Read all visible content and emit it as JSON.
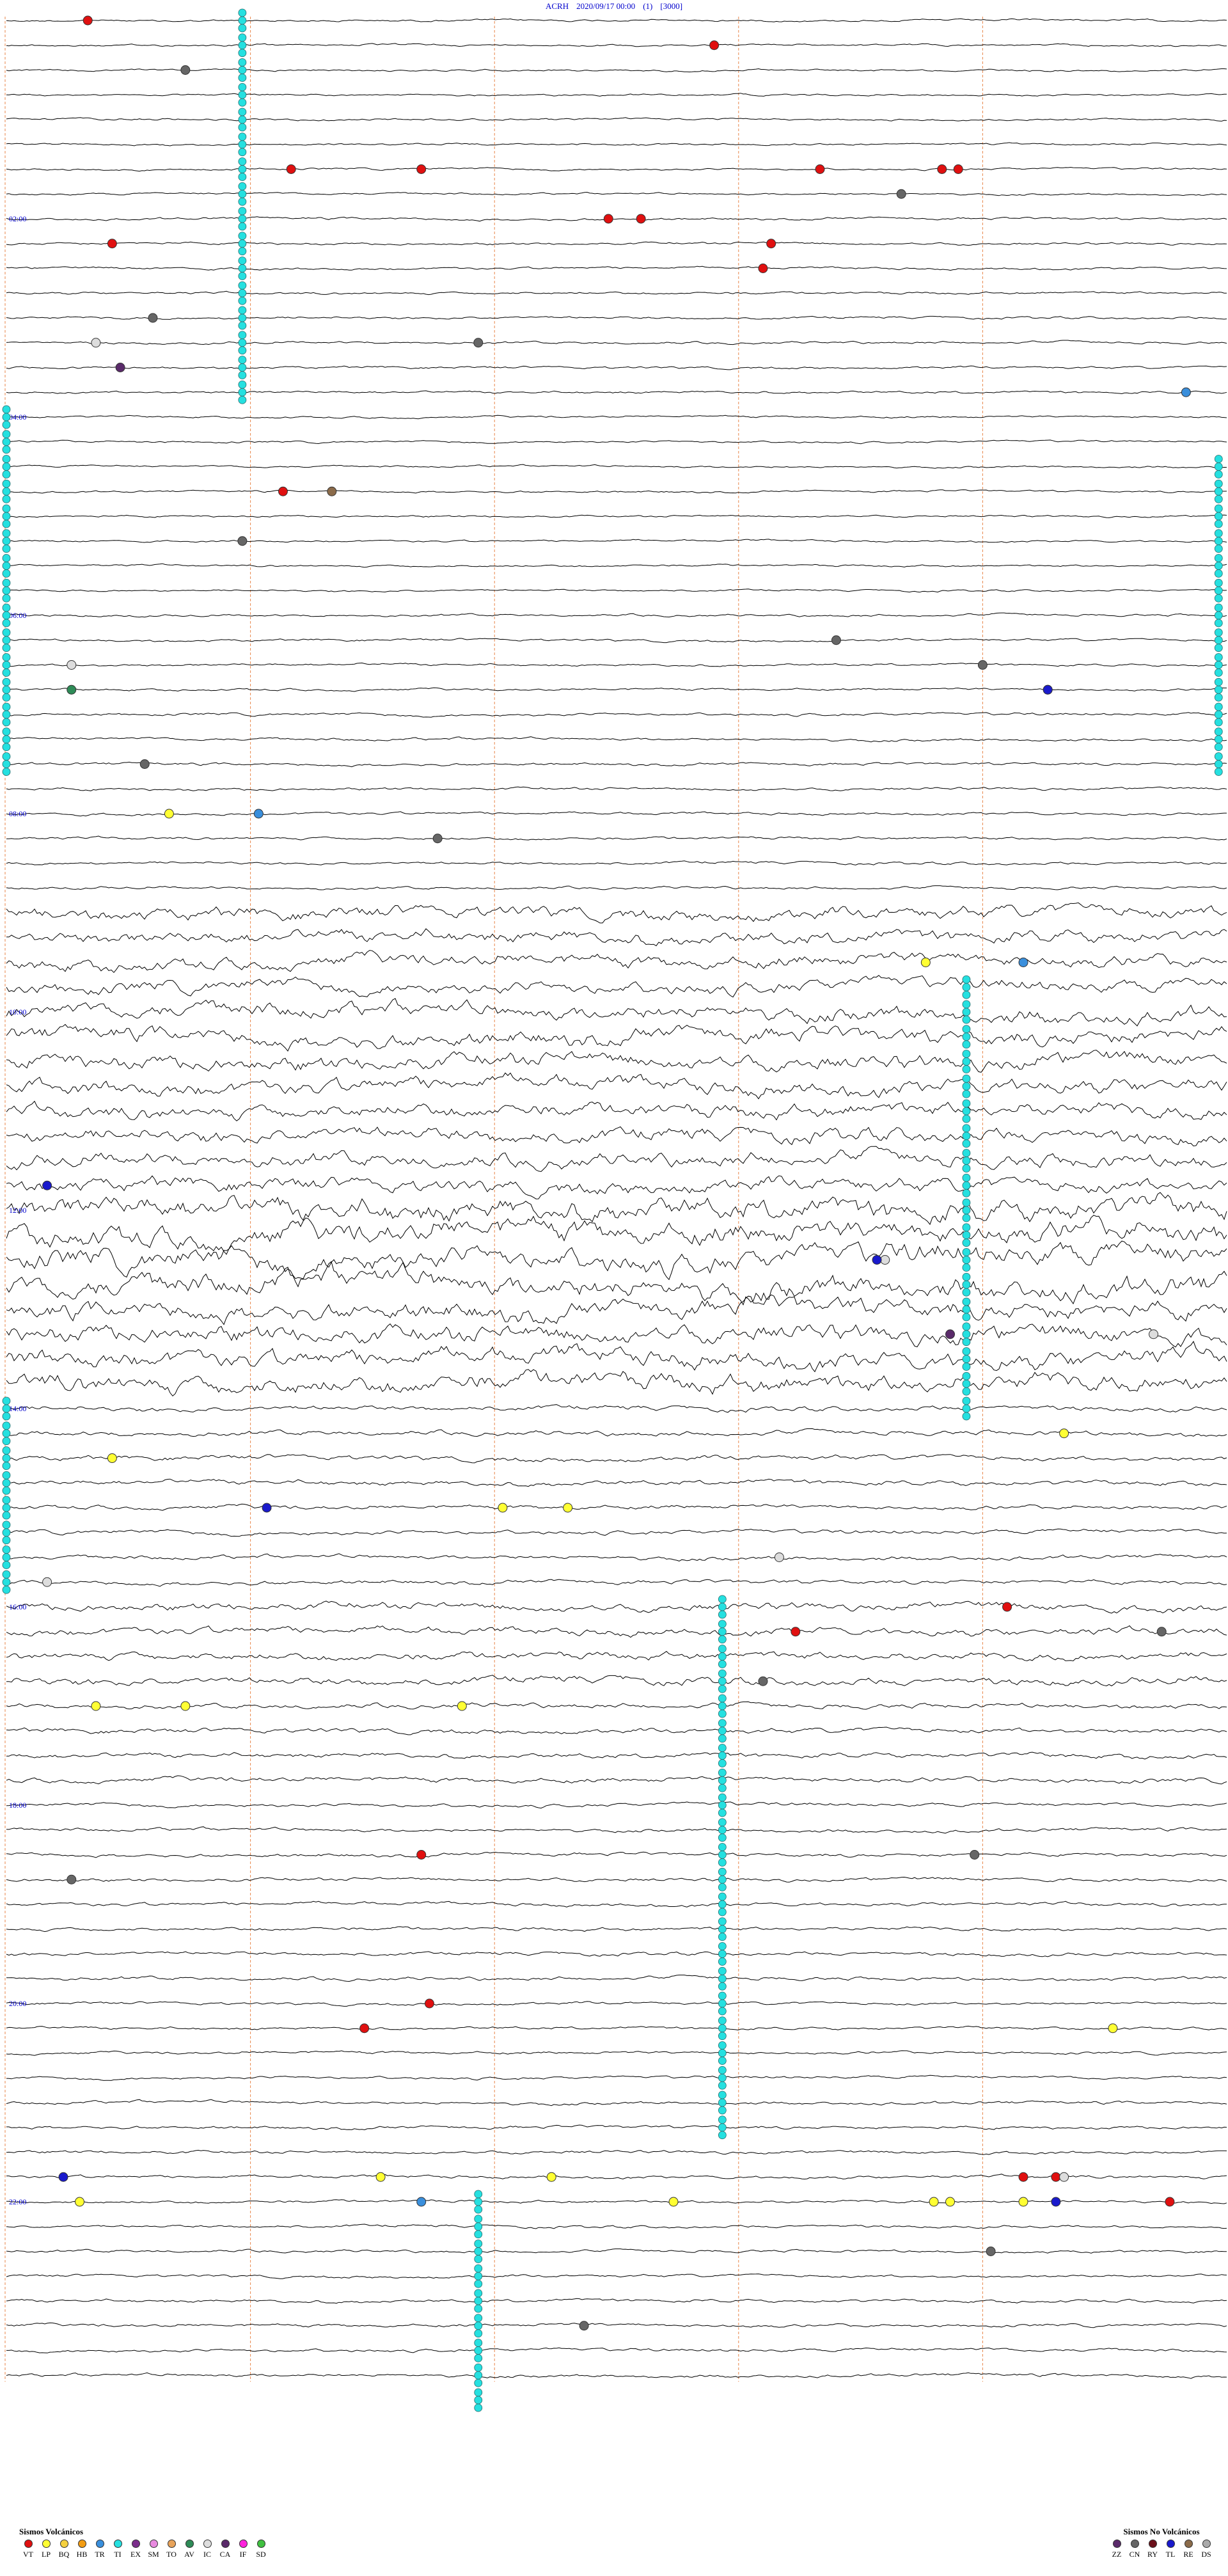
{
  "header": {
    "station": "ACRH",
    "datetime": "2020/09/17 00:00",
    "channel": "(1)",
    "scale": "[3000]"
  },
  "colors": {
    "trace": "#000000",
    "grid_vertical": "#e8864a",
    "hour_label": "#0000cc",
    "background": "#ffffff"
  },
  "chart_data": {
    "type": "helicorder",
    "rows_per_hour": 4,
    "minutes_per_row": 15,
    "x": {
      "label": "",
      "range_min": [
        0,
        15
      ],
      "grid_min": [
        3,
        6,
        9,
        12
      ]
    },
    "y_hour_labels": [
      "02:00",
      "04:00",
      "06:00",
      "08:00",
      "10:00",
      "12:00",
      "14:00",
      "16:00",
      "18:00",
      "20:00",
      "22:00"
    ],
    "amplitude_by_hour": [
      0.3,
      0.3,
      0.35,
      0.35,
      0.3,
      0.3,
      0.35,
      0.4,
      0.4,
      1.8,
      2.2,
      2.0,
      3.2,
      2.6,
      0.7,
      0.6,
      1.1,
      0.7,
      0.5,
      0.5,
      0.4,
      0.45,
      0.4,
      0.45
    ],
    "events": [
      {
        "type": "VT",
        "hour": 0,
        "row": 0,
        "min": 1.0
      },
      {
        "type": "VT",
        "hour": 0,
        "row": 1,
        "min": 8.7
      },
      {
        "type": "VT",
        "hour": 1,
        "row": 2,
        "min": 3.5
      },
      {
        "type": "VT",
        "hour": 1,
        "row": 2,
        "min": 5.1
      },
      {
        "type": "VT",
        "hour": 1,
        "row": 2,
        "min": 10.0
      },
      {
        "type": "VT",
        "hour": 1,
        "row": 2,
        "min": 11.5
      },
      {
        "type": "VT",
        "hour": 1,
        "row": 2,
        "min": 11.7
      },
      {
        "type": "VT",
        "hour": 2,
        "row": 0,
        "min": 7.4
      },
      {
        "type": "VT",
        "hour": 2,
        "row": 0,
        "min": 7.8
      },
      {
        "type": "VT",
        "hour": 2,
        "row": 1,
        "min": 1.3
      },
      {
        "type": "VT",
        "hour": 2,
        "row": 1,
        "min": 9.4
      },
      {
        "type": "VT",
        "hour": 2,
        "row": 2,
        "min": 9.3
      },
      {
        "type": "VT",
        "hour": 4,
        "row": 3,
        "min": 3.4
      },
      {
        "type": "VT",
        "hour": 16,
        "row": 1,
        "min": 9.7
      },
      {
        "type": "VT",
        "hour": 16,
        "row": 0,
        "min": 12.3
      },
      {
        "type": "VT",
        "hour": 18,
        "row": 2,
        "min": 5.1
      },
      {
        "type": "VT",
        "hour": 20,
        "row": 0,
        "min": 5.2
      },
      {
        "type": "VT",
        "hour": 20,
        "row": 1,
        "min": 4.4
      },
      {
        "type": "VT",
        "hour": 21,
        "row": 3,
        "min": 12.5
      },
      {
        "type": "VT",
        "hour": 21,
        "row": 3,
        "min": 12.9
      },
      {
        "type": "VT",
        "hour": 22,
        "row": 0,
        "min": 14.3
      },
      {
        "type": "LP",
        "hour": 8,
        "row": 0,
        "min": 2.0
      },
      {
        "type": "LP",
        "hour": 9,
        "row": 2,
        "min": 11.3
      },
      {
        "type": "LP",
        "hour": 14,
        "row": 2,
        "min": 1.3
      },
      {
        "type": "LP",
        "hour": 14,
        "row": 1,
        "min": 13.0
      },
      {
        "type": "LP",
        "hour": 15,
        "row": 0,
        "min": 6.1
      },
      {
        "type": "LP",
        "hour": 15,
        "row": 0,
        "min": 6.9
      },
      {
        "type": "LP",
        "hour": 17,
        "row": 0,
        "min": 1.1
      },
      {
        "type": "LP",
        "hour": 17,
        "row": 0,
        "min": 2.2
      },
      {
        "type": "LP",
        "hour": 17,
        "row": 0,
        "min": 5.6
      },
      {
        "type": "LP",
        "hour": 20,
        "row": 1,
        "min": 13.6
      },
      {
        "type": "LP",
        "hour": 21,
        "row": 3,
        "min": 4.6
      },
      {
        "type": "LP",
        "hour": 21,
        "row": 3,
        "min": 6.7
      },
      {
        "type": "LP",
        "hour": 22,
        "row": 0,
        "min": 8.2
      },
      {
        "type": "LP",
        "hour": 22,
        "row": 0,
        "min": 11.4
      },
      {
        "type": "LP",
        "hour": 22,
        "row": 0,
        "min": 11.6
      },
      {
        "type": "LP",
        "hour": 22,
        "row": 0,
        "min": 12.5
      },
      {
        "type": "LP",
        "hour": 22,
        "row": 0,
        "min": 0.9
      },
      {
        "type": "TR",
        "hour": 6,
        "row": 3,
        "min": 12.8
      },
      {
        "type": "TR",
        "hour": 8,
        "row": 0,
        "min": 3.1
      },
      {
        "type": "TR",
        "hour": 9,
        "row": 2,
        "min": 12.5
      },
      {
        "type": "TR",
        "hour": 22,
        "row": 0,
        "min": 5.1
      },
      {
        "type": "TR",
        "hour": 3,
        "row": 3,
        "min": 14.5
      },
      {
        "type": "IC",
        "hour": 3,
        "row": 1,
        "min": 1.1
      },
      {
        "type": "IC",
        "hour": 12,
        "row": 2,
        "min": 10.8
      },
      {
        "type": "IC",
        "hour": 13,
        "row": 1,
        "min": 14.1
      },
      {
        "type": "IC",
        "hour": 15,
        "row": 2,
        "min": 9.5
      },
      {
        "type": "IC",
        "hour": 15,
        "row": 3,
        "min": 0.5
      },
      {
        "type": "IC",
        "hour": 21,
        "row": 3,
        "min": 13.0
      },
      {
        "type": "IC",
        "hour": 6,
        "row": 2,
        "min": 0.8
      },
      {
        "type": "CN",
        "hour": 0,
        "row": 2,
        "min": 2.2
      },
      {
        "type": "CN",
        "hour": 1,
        "row": 3,
        "min": 11.0
      },
      {
        "type": "CN",
        "hour": 3,
        "row": 0,
        "min": 1.8
      },
      {
        "type": "CN",
        "hour": 3,
        "row": 1,
        "min": 5.8
      },
      {
        "type": "CN",
        "hour": 5,
        "row": 1,
        "min": 2.9
      },
      {
        "type": "CN",
        "hour": 6,
        "row": 1,
        "min": 10.2
      },
      {
        "type": "CN",
        "hour": 6,
        "row": 2,
        "min": 12.0
      },
      {
        "type": "CN",
        "hour": 7,
        "row": 2,
        "min": 1.7
      },
      {
        "type": "CN",
        "hour": 8,
        "row": 1,
        "min": 5.3
      },
      {
        "type": "CN",
        "hour": 16,
        "row": 1,
        "min": 14.2
      },
      {
        "type": "CN",
        "hour": 16,
        "row": 3,
        "min": 9.3
      },
      {
        "type": "CN",
        "hour": 18,
        "row": 2,
        "min": 11.9
      },
      {
        "type": "CN",
        "hour": 18,
        "row": 3,
        "min": 0.8
      },
      {
        "type": "CN",
        "hour": 22,
        "row": 2,
        "min": 12.1
      },
      {
        "type": "CN",
        "hour": 23,
        "row": 1,
        "min": 7.1
      },
      {
        "type": "TL",
        "hour": 6,
        "row": 3,
        "min": 12.8
      },
      {
        "type": "TL",
        "hour": 11,
        "row": 3,
        "min": 0.5
      },
      {
        "type": "TL",
        "hour": 12,
        "row": 2,
        "min": 10.7
      },
      {
        "type": "TL",
        "hour": 15,
        "row": 0,
        "min": 3.2
      },
      {
        "type": "TL",
        "hour": 21,
        "row": 3,
        "min": 0.7
      },
      {
        "type": "TL",
        "hour": 22,
        "row": 0,
        "min": 12.9
      },
      {
        "type": "ZZ",
        "hour": 3,
        "row": 2,
        "min": 1.4
      },
      {
        "type": "ZZ",
        "hour": 13,
        "row": 1,
        "min": 11.6
      },
      {
        "type": "AV",
        "hour": 6,
        "row": 3,
        "min": 0.8
      },
      {
        "type": "RE",
        "hour": 4,
        "row": 3,
        "min": 4.0
      }
    ],
    "marker_columns": [
      {
        "min": 2.9,
        "hour_start": 0.0,
        "hour_end": 3.75
      },
      {
        "min": 0.0,
        "hour_start": 4.0,
        "hour_end": 7.5
      },
      {
        "min": 14.9,
        "hour_start": 4.5,
        "hour_end": 7.5
      },
      {
        "min": 11.8,
        "hour_start": 9.7,
        "hour_end": 13.9
      },
      {
        "min": 0.0,
        "hour_start": 14.0,
        "hour_end": 15.8
      },
      {
        "min": 8.8,
        "hour_start": 16.0,
        "hour_end": 21.2
      },
      {
        "min": 5.8,
        "hour_start": 22.0,
        "hour_end": 23.9
      }
    ]
  },
  "legend": {
    "volcanic_title": "Sismos Volcánicos",
    "volcanic": [
      {
        "code": "VT",
        "color": "#e01010"
      },
      {
        "code": "LP",
        "color": "#ffff33"
      },
      {
        "code": "BQ",
        "color": "#f4d03f"
      },
      {
        "code": "HB",
        "color": "#f39c12"
      },
      {
        "code": "TR",
        "color": "#3a8fdc"
      },
      {
        "code": "TI",
        "color": "#25e0e0"
      },
      {
        "code": "EX",
        "color": "#7b2d8b"
      },
      {
        "code": "SM",
        "color": "#e88ae0"
      },
      {
        "code": "TO",
        "color": "#e8a35a"
      },
      {
        "code": "AV",
        "color": "#2e8b57"
      },
      {
        "code": "IC",
        "color": "#dddddd"
      },
      {
        "code": "CA",
        "color": "#5a2a6a"
      },
      {
        "code": "IF",
        "color": "#ff22dd"
      },
      {
        "code": "SD",
        "color": "#40c040"
      }
    ],
    "nonvolcanic_title": "Sismos No Volcánicos",
    "nonvolcanic": [
      {
        "code": "ZZ",
        "color": "#5a2a6a"
      },
      {
        "code": "CN",
        "color": "#666666"
      },
      {
        "code": "RY",
        "color": "#6b0f1a"
      },
      {
        "code": "TL",
        "color": "#1a1acc"
      },
      {
        "code": "RE",
        "color": "#8b6b4a"
      },
      {
        "code": "DS",
        "color": "#aaaaaa"
      }
    ]
  }
}
